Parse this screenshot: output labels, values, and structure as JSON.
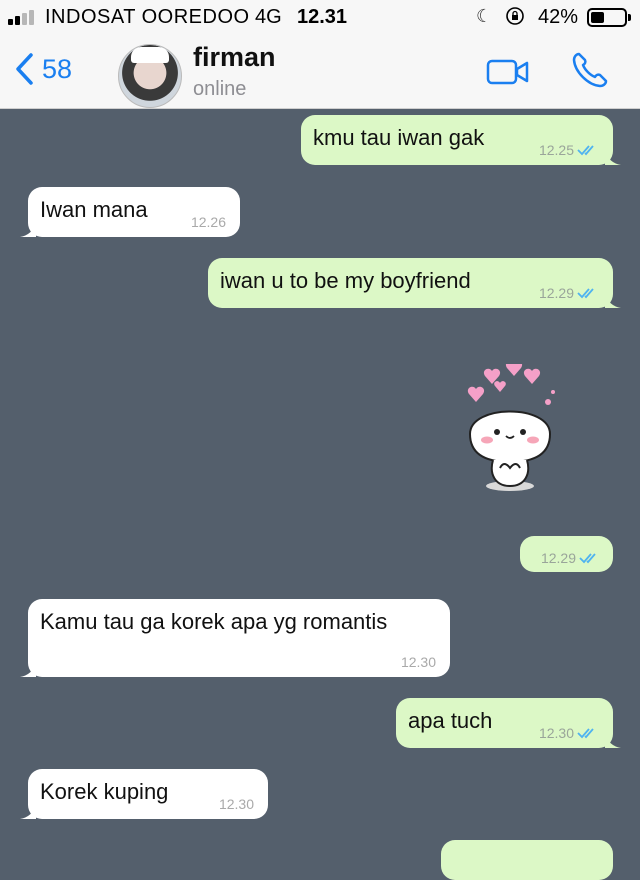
{
  "status_bar": {
    "carrier": "INDOSAT OOREDOO",
    "network": "4G",
    "time": "12.31",
    "battery_percent": "42%",
    "battery_level": 0.42,
    "signal_bars": 2,
    "icons": [
      "moon-icon",
      "rotation-lock-icon",
      "battery-icon"
    ]
  },
  "header": {
    "back_count": "58",
    "contact_name": "firman",
    "contact_status": "online",
    "icons": [
      "chevron-left-icon",
      "video-call-icon",
      "phone-icon"
    ]
  },
  "colors": {
    "accent": "#1a7ff0",
    "chat_bg": "#545f6c",
    "outgoing_bubble": "#dcf8c6",
    "incoming_bubble": "#ffffff",
    "read_tick": "#4fb3f0"
  },
  "messages": [
    {
      "direction": "outgoing",
      "text": "kmu tau iwan gak",
      "time": "12.25",
      "read": true
    },
    {
      "direction": "incoming",
      "text": "Iwan mana",
      "time": "12.26"
    },
    {
      "direction": "outgoing",
      "text": "iwan u to be my boyfriend",
      "time": "12.29",
      "read": true
    },
    {
      "direction": "outgoing",
      "text": "",
      "time": "12.29",
      "read": true,
      "sticker": "blushing-bun-sticker-with-hearts"
    },
    {
      "direction": "incoming",
      "text": "Kamu tau ga korek apa yg romantis",
      "time": "12.30"
    },
    {
      "direction": "outgoing",
      "text": "apa tuch",
      "time": "12.30",
      "read": true
    },
    {
      "direction": "incoming",
      "text": "Korek kuping",
      "time": "12.30"
    }
  ]
}
